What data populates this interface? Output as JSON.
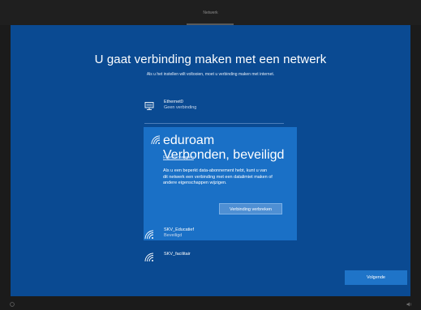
{
  "header": {
    "step_label": "Netwerk"
  },
  "main": {
    "title": "U gaat verbinding maken met een netwerk",
    "subtitle": "Als u het instellen wilt voltooien, moet u verbinding maken met internet."
  },
  "networks": {
    "ethernet": {
      "name": "Ethernet0",
      "status": "Geen verbinding",
      "icon": "ethernet-icon"
    },
    "eduroam": {
      "name": "eduroam",
      "status": "Verbonden, beveiligd",
      "icon": "wifi-icon",
      "properties_link": "Eigenschappen",
      "info": "Als u een beperkt data-abonnement hebt, kunt u van dit netwerk een verbinding met een datalimiet maken of andere eigenschappen wijzigen.",
      "disconnect_label": "Verbinding verbreken"
    },
    "skv_educatief": {
      "name": "SKV_Educatief",
      "status": "Beveiligd",
      "icon": "wifi-icon"
    },
    "skv_facilitair": {
      "name": "SKV_facilitair",
      "icon": "wifi-icon"
    }
  },
  "footer": {
    "next_label": "Volgende",
    "ease_icon": "ease-of-access-icon",
    "volume_icon": "volume-icon"
  },
  "colors": {
    "background": "#0a4a92",
    "selected": "#1a70c6",
    "button": "#1f74c8",
    "frame": "#1b1b1b"
  }
}
